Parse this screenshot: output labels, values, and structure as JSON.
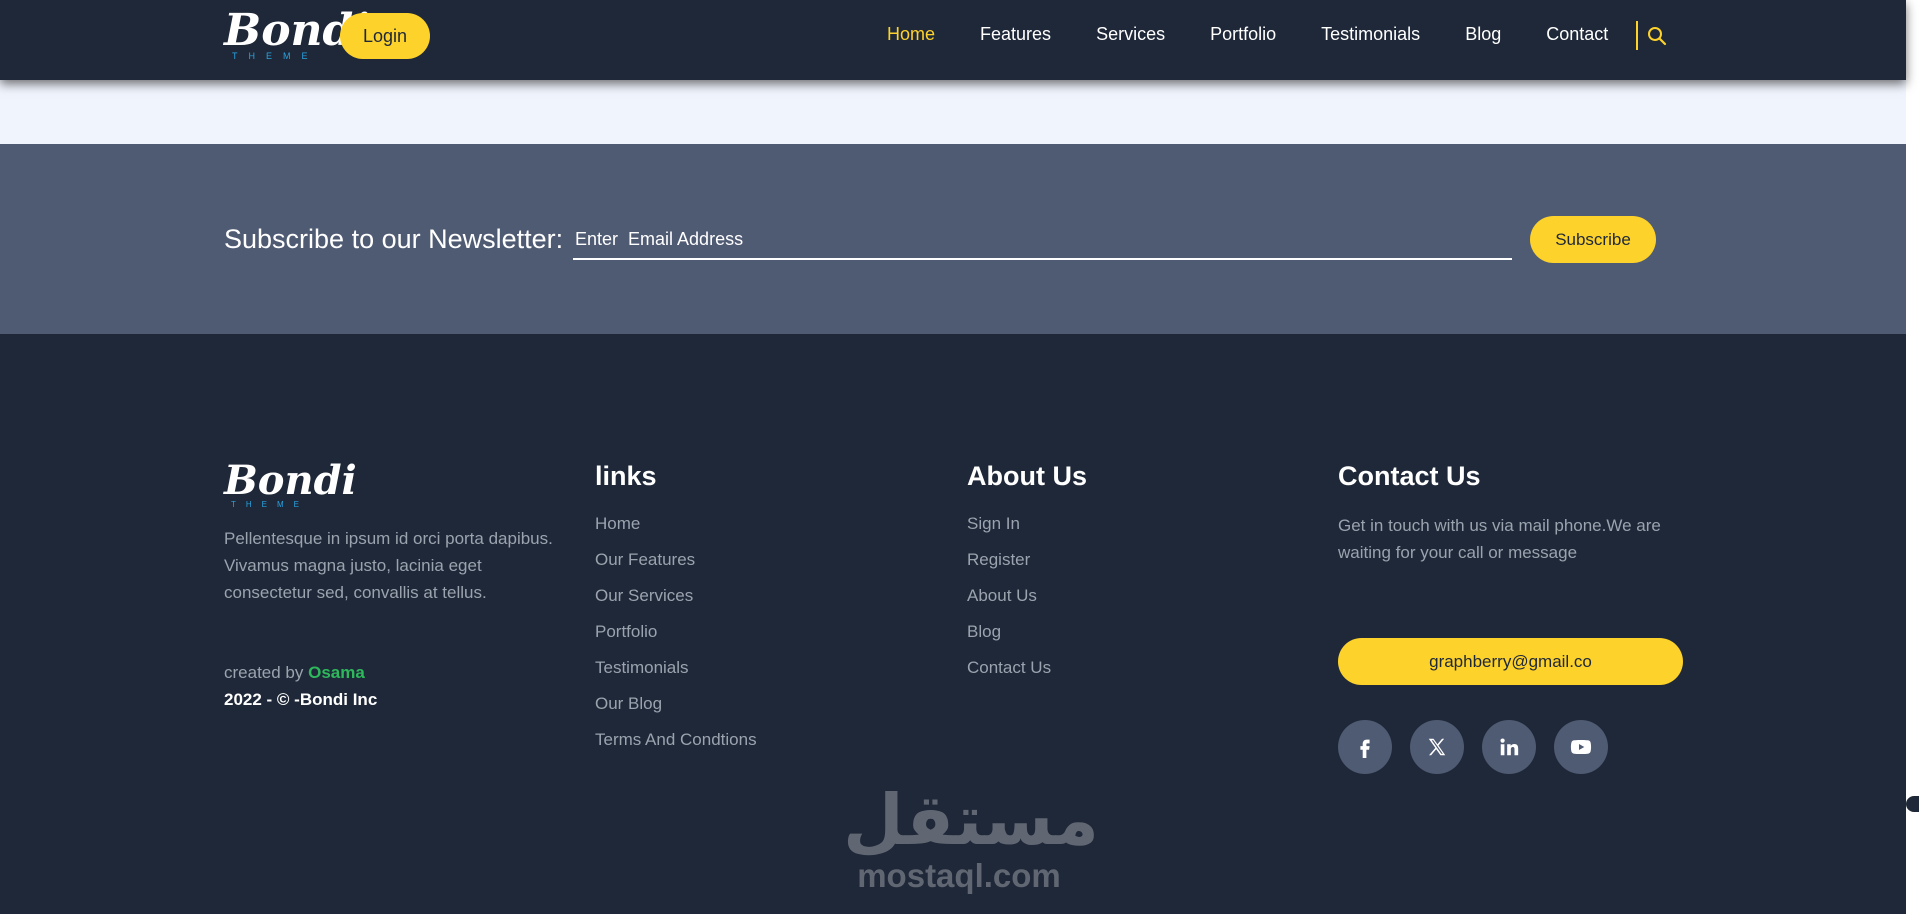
{
  "header": {
    "logo": {
      "script": "Bondi",
      "sub": "THEME"
    },
    "login_label": "Login",
    "nav": [
      {
        "label": "Home",
        "active": true
      },
      {
        "label": "Features"
      },
      {
        "label": "Services"
      },
      {
        "label": "Portfolio"
      },
      {
        "label": "Testimonials"
      },
      {
        "label": "Blog"
      },
      {
        "label": "Contact"
      }
    ],
    "search_icon": "search-icon"
  },
  "newsletter": {
    "label": "Subscribe to our Newsletter:",
    "input_placeholder": "Enter  Email Address",
    "button_label": "Subscribe"
  },
  "footer": {
    "brand": {
      "logo": {
        "script": "Bondi",
        "sub": "THEME"
      },
      "description": "Pellentesque in ipsum id orci porta dapibus. Vivamus magna justo, lacinia eget consectetur sed, convallis at tellus.",
      "created_by_prefix": "created by",
      "author": "Osama",
      "copyright": "2022 - © -Bondi Inc"
    },
    "links": {
      "title": "links",
      "items": [
        "Home",
        "Our Features",
        "Our Services",
        "Portfolio",
        "Testimonials",
        "Our Blog",
        "Terms And Condtions"
      ]
    },
    "about": {
      "title": "About Us",
      "items": [
        "Sign In",
        "Register",
        "About Us",
        "Blog",
        "Contact Us"
      ]
    },
    "contact": {
      "title": "Contact Us",
      "text": "Get in touch with us via mail phone.We are waiting for your call or message",
      "email": "graphberry@gmail.co",
      "socials": [
        "facebook-icon",
        "x-twitter-icon",
        "linkedin-icon",
        "youtube-icon"
      ]
    }
  },
  "watermark": {
    "arabic": "مستقل",
    "latin": "mostaql.com"
  },
  "colors": {
    "navy": "#1f2838",
    "slate": "#4f5a73",
    "accent": "#fdd22b",
    "light_bg": "#f0f4fd",
    "muted_text": "#9aa3ae",
    "author_green": "#2eb85c",
    "logo_sub_blue": "#29a3e0"
  }
}
